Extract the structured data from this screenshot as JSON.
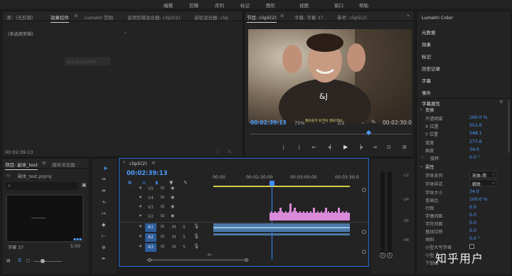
{
  "menu": [
    "编辑",
    "剪辑",
    "序列",
    "标记",
    "图形",
    "视图",
    "窗口",
    "帮助"
  ],
  "source_panel": {
    "tabs": [
      "源：(无剪辑)",
      "效果控件",
      "Lumetri 范围",
      "音频剪辑混合器: clip5(2)",
      "音轨混合器: clip"
    ],
    "no_clip": "(未选择剪辑)",
    "placeholder_box": "(在此处选择剪辑)",
    "timecode": "00:02:39:13"
  },
  "program_panel": {
    "tabs": [
      "节目: clip5(2)",
      "字幕: 字幕 37",
      "参考: clip5(2)"
    ],
    "subtitle_text": "我的名字 好不好 我好不好",
    "timecode": "00:02:39:13",
    "zoom": "75%",
    "resolution": "1/2",
    "duration": "00:02:30:0"
  },
  "right_panel": {
    "items": [
      "Lumetri Color",
      "元数据",
      "效果",
      "标记",
      "历史记录",
      "字幕",
      "事件"
    ],
    "title": "字幕属性",
    "transform_section": "变换",
    "transform_props": [
      {
        "label": "不透明度",
        "value": "100.0 %"
      },
      {
        "label": "X 位置",
        "value": "552.6"
      },
      {
        "label": "Y 位置",
        "value": "548.1"
      },
      {
        "label": "宽度",
        "value": "277.6"
      },
      {
        "label": "高度",
        "value": "34.0"
      },
      {
        "label": "旋转",
        "value": "0.0 °"
      }
    ],
    "props_section": "属性",
    "font_family_label": "字体系列",
    "font_family_value": "宋体-简",
    "font_style_label": "字体样式",
    "font_style_value": "细体",
    "text_props": [
      {
        "label": "字体大小",
        "value": "34.0"
      },
      {
        "label": "宽高比",
        "value": "100.0 %"
      },
      {
        "label": "行距",
        "value": "0.0"
      },
      {
        "label": "字偶间距",
        "value": "0.0"
      },
      {
        "label": "字符间距",
        "value": "0.0"
      },
      {
        "label": "基线位移",
        "value": "0.0"
      },
      {
        "label": "倾斜",
        "value": "0.0 °"
      }
    ],
    "caps_label": "小型大写字母",
    "extra_labels": [
      "小型",
      "下划线"
    ]
  },
  "project_panel": {
    "tabs": [
      "项目: 副本_test",
      "媒体浏览器"
    ],
    "file": "副本_test.prproj",
    "clip_name": "字幕 37",
    "clip_duration": "5:00"
  },
  "timeline": {
    "tab": "clip5(2)",
    "timecode": "00:02:39:13",
    "ruler": [
      "00:00",
      "00:02:30:00",
      "00:03:00:00",
      "00:03:30:0"
    ],
    "video_tracks": [
      "V5",
      "V4",
      "V3",
      "V2"
    ],
    "audio_tracks": [
      "A1",
      "A2",
      "A3"
    ],
    "track_btn_m": "M",
    "track_btn_s": "S"
  },
  "meter": {
    "scale": [
      "-12",
      "-24",
      "-36",
      "-48"
    ],
    "solo": "S"
  },
  "watermark": "知乎用户",
  "colors": {
    "accent": "#4a9dff",
    "caption_pink": "#d98ad9",
    "playhead": "#3b8cff"
  }
}
